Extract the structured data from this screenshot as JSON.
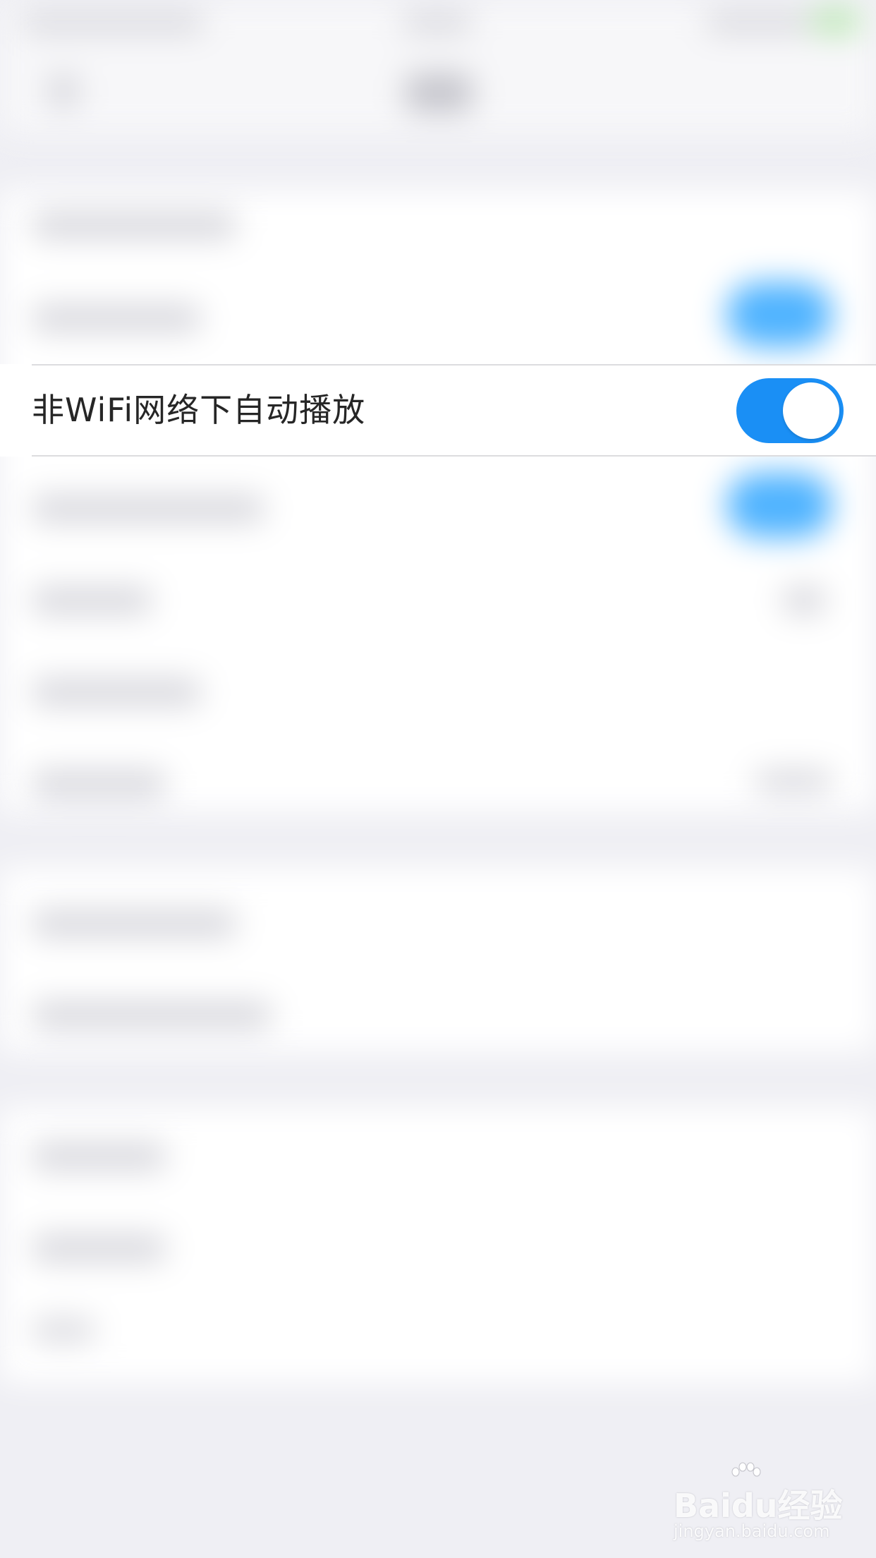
{
  "settings": {
    "autoplay_non_wifi": {
      "label": "非WiFi网络下自动播放",
      "enabled": true
    }
  },
  "colors": {
    "toggle_on": "#1a8ff5",
    "background": "#efeff4",
    "row_background": "#ffffff",
    "label_text": "#262626"
  },
  "watermark": {
    "logo": "Baidu经验",
    "url": "jingyan.baidu.com"
  }
}
